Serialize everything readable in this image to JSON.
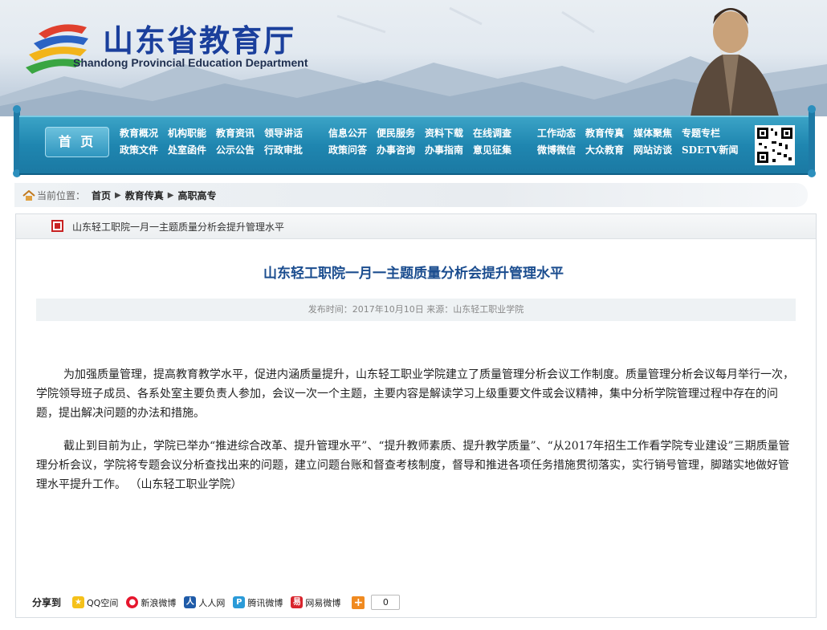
{
  "header": {
    "title_cn": "山东省教育厅",
    "title_en": "Shandong Provincial Education Department"
  },
  "nav": {
    "home": "首 页",
    "group1": {
      "row1": [
        "教育概况",
        "机构职能",
        "教育资讯",
        "领导讲话"
      ],
      "row2": [
        "政策文件",
        "处室函件",
        "公示公告",
        "行政审批"
      ]
    },
    "group2": {
      "row1": [
        "信息公开",
        "便民服务",
        "资料下载",
        "在线调查"
      ],
      "row2": [
        "政策问答",
        "办事咨询",
        "办事指南",
        "意见征集"
      ]
    },
    "group3": {
      "row1": [
        "工作动态",
        "教育传真",
        "媒体聚焦",
        "专题专栏"
      ],
      "row2": [
        "微博微信",
        "大众教育",
        "网站访谈",
        "SDETV新闻"
      ]
    }
  },
  "breadcrumb": {
    "label": "当前位置：",
    "items": [
      "首页",
      "教育传真",
      "高职高专"
    ]
  },
  "panel_head": "山东轻工职院一月一主题质量分析会提升管理水平",
  "article": {
    "title": "山东轻工职院一月一主题质量分析会提升管理水平",
    "meta": "发布时间：2017年10月10日 来源：山东轻工职业学院",
    "paragraphs": [
      "为加强质量管理，提高教育教学水平，促进内涵质量提升，山东轻工职业学院建立了质量管理分析会议工作制度。质量管理分析会议每月举行一次，学院领导班子成员、各系处室主要负责人参加，会议一次一个主题，主要内容是解读学习上级重要文件或会议精神，集中分析学院管理过程中存在的问题，提出解决问题的办法和措施。",
      "截止到目前为止，学院已举办“推进综合改革、提升管理水平”、“提升教师素质、提升教学质量”、“从2017年招生工作看学院专业建设”三期质量管理分析会议，学院将专题会议分析查找出来的问题，建立问题台账和督查考核制度，督导和推进各项任务措施贯彻落实，实行销号管理，脚踏实地做好管理水平提升工作。 （山东轻工职业学院）"
    ]
  },
  "share": {
    "label": "分享到",
    "items": [
      "QQ空间",
      "新浪微博",
      "人人网",
      "腾讯微博",
      "网易微博"
    ],
    "plus": "+",
    "count": "0"
  },
  "colors": {
    "nav_blue": "#1f86b0",
    "title_blue": "#1a3f9c",
    "article_title": "#1b4d8f",
    "marker_red": "#c82222"
  }
}
